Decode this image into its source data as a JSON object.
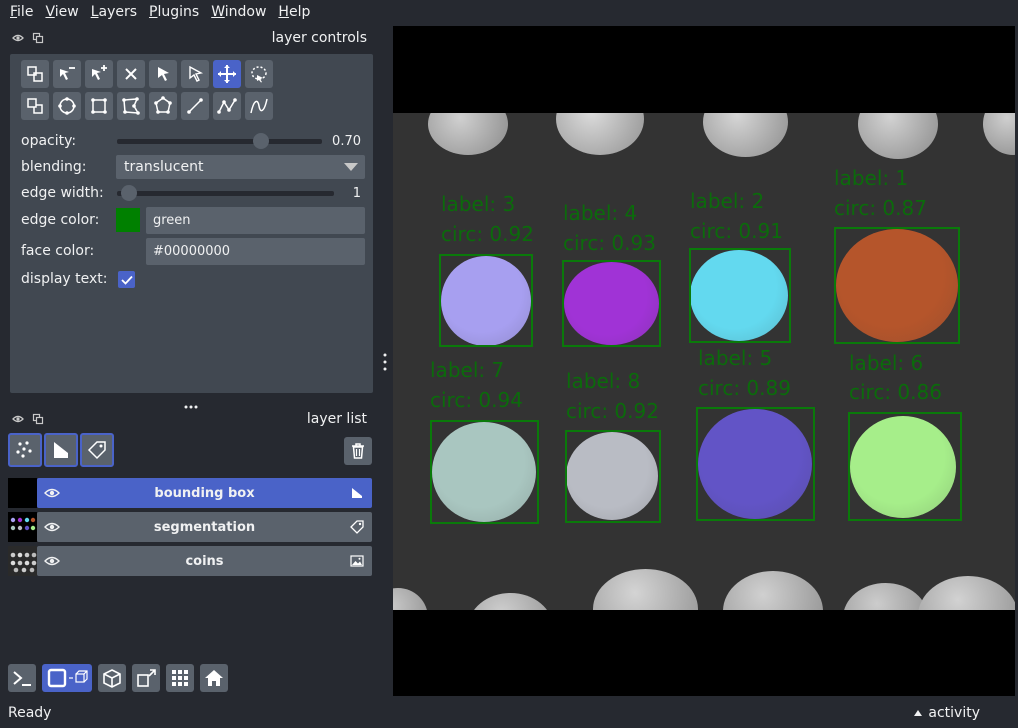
{
  "menubar": {
    "items": [
      {
        "first": "F",
        "rest": "ile"
      },
      {
        "first": "V",
        "rest": "iew"
      },
      {
        "first": "L",
        "rest": "ayers"
      },
      {
        "first": "P",
        "rest": "lugins"
      },
      {
        "first": "W",
        "rest": "indow"
      },
      {
        "first": "H",
        "rest": "elp"
      }
    ]
  },
  "controls": {
    "title": "layer controls",
    "opacity_label": "opacity:",
    "opacity_value": "0.70",
    "opacity_fraction": 0.7,
    "blending_label": "blending:",
    "blending_value": "translucent",
    "edge_width_label": "edge width:",
    "edge_width_value": "1",
    "edge_color_label": "edge color:",
    "edge_color_value": "green",
    "edge_color_swatch": "#008000",
    "face_color_label": "face color:",
    "face_color_value": "#00000000",
    "display_text_label": "display text:",
    "display_text_checked": true
  },
  "layer_list": {
    "title": "layer list",
    "layers": [
      {
        "name": "bounding box",
        "type": "shapes",
        "selected": true
      },
      {
        "name": "segmentation",
        "type": "labels",
        "selected": false
      },
      {
        "name": "coins",
        "type": "image",
        "selected": false
      }
    ]
  },
  "canvas": {
    "boxes": [
      {
        "label": "label: 3",
        "circ": "circ: 0.92",
        "color": "#a79ff0"
      },
      {
        "label": "label: 4",
        "circ": "circ: 0.93",
        "color": "#a033d6"
      },
      {
        "label": "label: 2",
        "circ": "circ: 0.91",
        "color": "#63d9ef"
      },
      {
        "label": "label: 1",
        "circ": "circ: 0.87",
        "color": "#b5552b"
      },
      {
        "label": "label: 7",
        "circ": "circ: 0.94",
        "color": "#a9c6c0"
      },
      {
        "label": "label: 8",
        "circ": "circ: 0.92",
        "color": "#b9bcc4"
      },
      {
        "label": "label: 5",
        "circ": "circ: 0.89",
        "color": "#6254c6"
      },
      {
        "label": "label: 6",
        "circ": "circ: 0.86",
        "color": "#a6ee8a"
      }
    ]
  },
  "status": {
    "text": "Ready",
    "activity": "activity"
  },
  "colors": {
    "background": "#262930",
    "panel": "#414851",
    "button": "#5a626c",
    "accent": "#4a63c8",
    "bbox_edge": "#0a7a0a"
  }
}
